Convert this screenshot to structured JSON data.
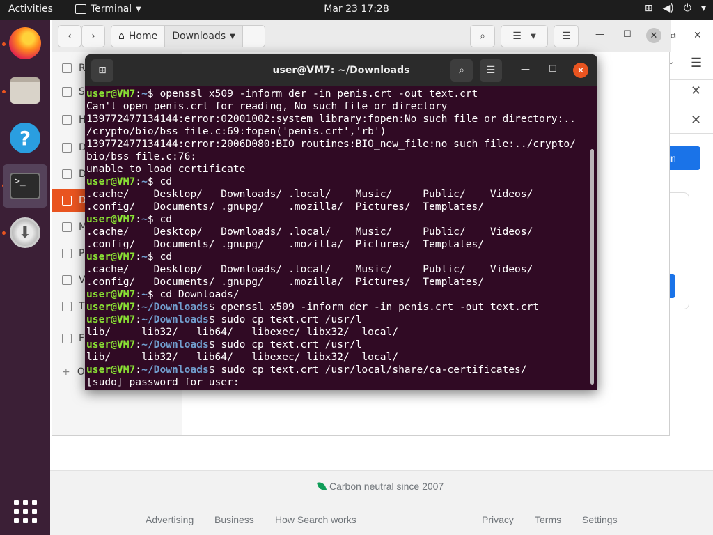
{
  "topbar": {
    "activities": "Activities",
    "app_name": "Terminal",
    "clock": "Mar 23  17:28"
  },
  "dock": {
    "items": [
      "firefox-icon",
      "files-icon",
      "help-icon",
      "terminal-icon",
      "installer-icon",
      "app-grid-icon"
    ]
  },
  "nautilus": {
    "path_home": "Home",
    "path_current": "Downloads",
    "sidebar_partial": [
      "R",
      "S",
      "H",
      "D",
      "D",
      "D",
      "M",
      "P",
      "V",
      "T",
      "F",
      "O"
    ]
  },
  "browser": {
    "carbon": "Carbon neutral since 2007",
    "footer_left": [
      "Advertising",
      "Business",
      "How Search works"
    ],
    "footer_right": [
      "Privacy",
      "Terms",
      "Settings"
    ],
    "signin_partial": "in"
  },
  "terminal": {
    "title": "user@VM7: ~/Downloads",
    "lines": [
      {
        "user": "user@VM7",
        "path": "~",
        "cmd": "$ openssl x509 -inform der -in penis.crt -out text.crt"
      },
      {
        "text": "Can't open penis.crt for reading, No such file or directory"
      },
      {
        "text": "139772477134144:error:02001002:system library:fopen:No such file or directory:.."
      },
      {
        "text": "/crypto/bio/bss_file.c:69:fopen('penis.crt','rb')"
      },
      {
        "text": "139772477134144:error:2006D080:BIO routines:BIO_new_file:no such file:../crypto/"
      },
      {
        "text": "bio/bss_file.c:76:"
      },
      {
        "text": "unable to load certificate"
      },
      {
        "user": "user@VM7",
        "path": "~",
        "cmd": "$ cd"
      },
      {
        "text": ".cache/    Desktop/   Downloads/ .local/    Music/     Public/    Videos/"
      },
      {
        "text": ".config/   Documents/ .gnupg/    .mozilla/  Pictures/  Templates/"
      },
      {
        "user": "user@VM7",
        "path": "~",
        "cmd": "$ cd"
      },
      {
        "text": ".cache/    Desktop/   Downloads/ .local/    Music/     Public/    Videos/"
      },
      {
        "text": ".config/   Documents/ .gnupg/    .mozilla/  Pictures/  Templates/"
      },
      {
        "user": "user@VM7",
        "path": "~",
        "cmd": "$ cd"
      },
      {
        "text": ".cache/    Desktop/   Downloads/ .local/    Music/     Public/    Videos/"
      },
      {
        "text": ".config/   Documents/ .gnupg/    .mozilla/  Pictures/  Templates/"
      },
      {
        "user": "user@VM7",
        "path": "~",
        "cmd": "$ cd Downloads/"
      },
      {
        "user": "user@VM7",
        "path": "~/Downloads",
        "cmd": "$ openssl x509 -inform der -in penis.crt -out text.crt"
      },
      {
        "user": "user@VM7",
        "path": "~/Downloads",
        "cmd": "$ sudo cp text.crt /usr/l"
      },
      {
        "text": "lib/     lib32/   lib64/   libexec/ libx32/  local/"
      },
      {
        "user": "user@VM7",
        "path": "~/Downloads",
        "cmd": "$ sudo cp text.crt /usr/l"
      },
      {
        "text": "lib/     lib32/   lib64/   libexec/ libx32/  local/"
      },
      {
        "user": "user@VM7",
        "path": "~/Downloads",
        "cmd": "$ sudo cp text.crt /usr/local/share/ca-certificates/"
      },
      {
        "text": "[sudo] password for user: "
      }
    ]
  }
}
